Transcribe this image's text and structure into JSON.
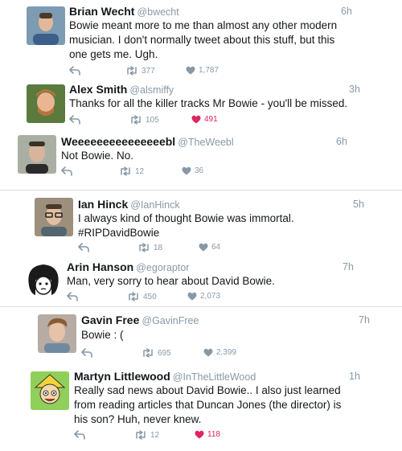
{
  "tweets": [
    {
      "name": "Brian Wecht",
      "handle": "@bwecht",
      "time": "6h",
      "lines": [
        "Bowie meant more to me than almost any other modern",
        "musician. I don't normally tweet about this stuff, but this",
        "one gets me. Ugh."
      ],
      "retweets": "377",
      "likes": "1,787",
      "liked": false
    },
    {
      "name": "Alex Smith",
      "handle": "@alsmiffy",
      "time": "3h",
      "lines": [
        "Thanks for all the killer tracks Mr Bowie - you'll be missed."
      ],
      "retweets": "105",
      "likes": "491",
      "liked": true
    },
    {
      "name": "Weeeeeeeeeeeeeeebl",
      "handle": "@TheWeebl",
      "time": "6h",
      "lines": [
        "Not Bowie. No."
      ],
      "retweets": "12",
      "likes": "36",
      "liked": false
    },
    {
      "name": "Ian Hinck",
      "handle": "@IanHinck",
      "time": "5h",
      "lines": [
        "I always kind of thought Bowie was immortal.",
        "#RIPDavidBowie"
      ],
      "retweets": "18",
      "likes": "64",
      "liked": false
    },
    {
      "name": "Arin Hanson",
      "handle": "@egoraptor",
      "time": "7h",
      "lines": [
        "Man, very sorry to hear about David Bowie."
      ],
      "retweets": "450",
      "likes": "2,073",
      "liked": false
    },
    {
      "name": "Gavin Free",
      "handle": "@GavinFree",
      "time": "7h",
      "lines": [
        "Bowie : ("
      ],
      "retweets": "695",
      "likes": "2,399",
      "liked": false
    },
    {
      "name": "Martyn Littlewood",
      "handle": "@InTheLittleWood",
      "time": "1h",
      "lines": [
        "Really sad news about David Bowie.. I also just learned",
        "from reading articles that Duncan Jones (the director) is",
        "his son? Huh, never knew."
      ],
      "retweets": "12",
      "likes": "118",
      "liked": true
    }
  ],
  "colors": {
    "text": "#14171a",
    "muted": "#8899a6",
    "like": "#e0245e",
    "divider": "#d7dde2"
  },
  "icons": {
    "reply": "reply-icon",
    "retweet": "retweet-icon",
    "like": "heart-icon"
  }
}
